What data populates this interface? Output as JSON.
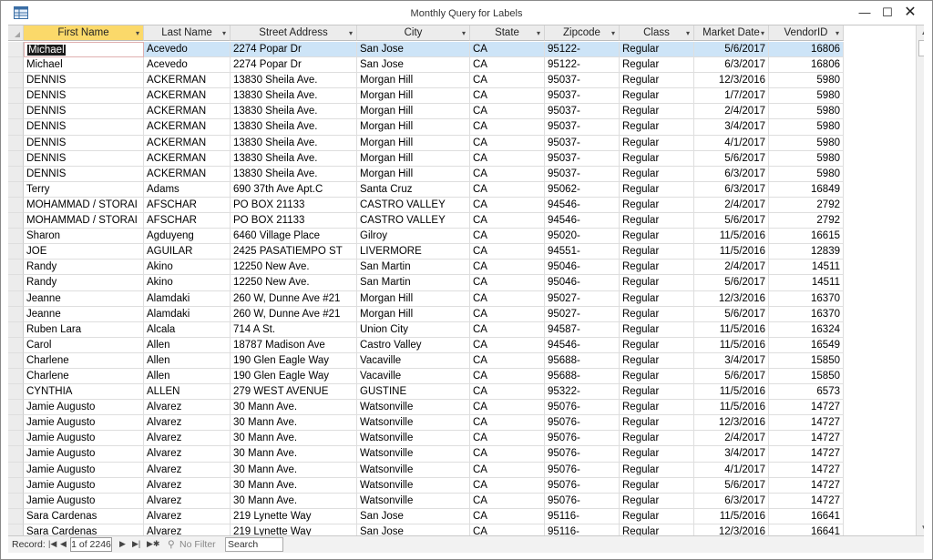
{
  "window": {
    "title": "Monthly Query for Labels",
    "minimize_glyph": "—",
    "maximize_glyph": "☐",
    "close_glyph": "✕"
  },
  "columns": [
    {
      "label": "First Name",
      "width": 132
    },
    {
      "label": "Last Name",
      "width": 95
    },
    {
      "label": "Street Address",
      "width": 139
    },
    {
      "label": "City",
      "width": 124
    },
    {
      "label": "State",
      "width": 82
    },
    {
      "label": "Zipcode",
      "width": 82
    },
    {
      "label": "Class",
      "width": 82
    },
    {
      "label": "Market Date",
      "width": 82
    },
    {
      "label": "VendorID",
      "width": 82
    }
  ],
  "rows": [
    [
      "Michael",
      "Acevedo",
      "2274 Popar Dr",
      "San Jose",
      "CA",
      "95122-",
      "Regular",
      "5/6/2017",
      "16806"
    ],
    [
      "Michael",
      "Acevedo",
      "2274 Popar Dr",
      "San Jose",
      "CA",
      "95122-",
      "Regular",
      "6/3/2017",
      "16806"
    ],
    [
      "DENNIS",
      "ACKERMAN",
      "13830 Sheila Ave.",
      "Morgan Hill",
      "CA",
      "95037-",
      "Regular",
      "12/3/2016",
      "5980"
    ],
    [
      "DENNIS",
      "ACKERMAN",
      "13830 Sheila Ave.",
      "Morgan Hill",
      "CA",
      "95037-",
      "Regular",
      "1/7/2017",
      "5980"
    ],
    [
      "DENNIS",
      "ACKERMAN",
      "13830 Sheila Ave.",
      "Morgan Hill",
      "CA",
      "95037-",
      "Regular",
      "2/4/2017",
      "5980"
    ],
    [
      "DENNIS",
      "ACKERMAN",
      "13830 Sheila Ave.",
      "Morgan Hill",
      "CA",
      "95037-",
      "Regular",
      "3/4/2017",
      "5980"
    ],
    [
      "DENNIS",
      "ACKERMAN",
      "13830 Sheila Ave.",
      "Morgan Hill",
      "CA",
      "95037-",
      "Regular",
      "4/1/2017",
      "5980"
    ],
    [
      "DENNIS",
      "ACKERMAN",
      "13830 Sheila Ave.",
      "Morgan Hill",
      "CA",
      "95037-",
      "Regular",
      "5/6/2017",
      "5980"
    ],
    [
      "DENNIS",
      "ACKERMAN",
      "13830 Sheila Ave.",
      "Morgan Hill",
      "CA",
      "95037-",
      "Regular",
      "6/3/2017",
      "5980"
    ],
    [
      "Terry",
      "Adams",
      "690 37th Ave Apt.C",
      "Santa Cruz",
      "CA",
      "95062-",
      "Regular",
      "6/3/2017",
      "16849"
    ],
    [
      "MOHAMMAD / STORAI",
      "AFSCHAR",
      "PO BOX 21133",
      "CASTRO VALLEY",
      "CA",
      "94546-",
      "Regular",
      "2/4/2017",
      "2792"
    ],
    [
      "MOHAMMAD / STORAI",
      "AFSCHAR",
      "PO BOX 21133",
      "CASTRO VALLEY",
      "CA",
      "94546-",
      "Regular",
      "5/6/2017",
      "2792"
    ],
    [
      "Sharon",
      "Agduyeng",
      "6460 Village Place",
      "Gilroy",
      "CA",
      "95020-",
      "Regular",
      "11/5/2016",
      "16615"
    ],
    [
      "JOE",
      "AGUILAR",
      "2425 PASATIEMPO ST",
      "LIVERMORE",
      "CA",
      "94551-",
      "Regular",
      "11/5/2016",
      "12839"
    ],
    [
      "Randy",
      "Akino",
      "12250 New Ave.",
      "San Martin",
      "CA",
      "95046-",
      "Regular",
      "2/4/2017",
      "14511"
    ],
    [
      "Randy",
      "Akino",
      "12250 New Ave.",
      "San Martin",
      "CA",
      "95046-",
      "Regular",
      "5/6/2017",
      "14511"
    ],
    [
      "Jeanne",
      "Alamdaki",
      "260 W, Dunne Ave #21",
      "Morgan Hill",
      "CA",
      "95027-",
      "Regular",
      "12/3/2016",
      "16370"
    ],
    [
      "Jeanne",
      "Alamdaki",
      "260 W, Dunne Ave #21",
      "Morgan Hill",
      "CA",
      "95027-",
      "Regular",
      "5/6/2017",
      "16370"
    ],
    [
      "Ruben Lara",
      "Alcala",
      "714 A St.",
      "Union City",
      "CA",
      "94587-",
      "Regular",
      "11/5/2016",
      "16324"
    ],
    [
      "Carol",
      "Allen",
      "18787 Madison Ave",
      "Castro Valley",
      "CA",
      "94546-",
      "Regular",
      "11/5/2016",
      "16549"
    ],
    [
      "Charlene",
      "Allen",
      "190 Glen Eagle Way",
      "Vacaville",
      "CA",
      "95688-",
      "Regular",
      "3/4/2017",
      "15850"
    ],
    [
      "Charlene",
      "Allen",
      "190 Glen Eagle Way",
      "Vacaville",
      "CA",
      "95688-",
      "Regular",
      "5/6/2017",
      "15850"
    ],
    [
      "CYNTHIA",
      "ALLEN",
      "279 WEST AVENUE",
      "GUSTINE",
      "CA",
      "95322-",
      "Regular",
      "11/5/2016",
      "6573"
    ],
    [
      "Jamie Augusto",
      "Alvarez",
      "30 Mann Ave.",
      "Watsonville",
      "CA",
      "95076-",
      "Regular",
      "11/5/2016",
      "14727"
    ],
    [
      "Jamie Augusto",
      "Alvarez",
      "30 Mann Ave.",
      "Watsonville",
      "CA",
      "95076-",
      "Regular",
      "12/3/2016",
      "14727"
    ],
    [
      "Jamie Augusto",
      "Alvarez",
      "30 Mann Ave.",
      "Watsonville",
      "CA",
      "95076-",
      "Regular",
      "2/4/2017",
      "14727"
    ],
    [
      "Jamie Augusto",
      "Alvarez",
      "30 Mann Ave.",
      "Watsonville",
      "CA",
      "95076-",
      "Regular",
      "3/4/2017",
      "14727"
    ],
    [
      "Jamie Augusto",
      "Alvarez",
      "30 Mann Ave.",
      "Watsonville",
      "CA",
      "95076-",
      "Regular",
      "4/1/2017",
      "14727"
    ],
    [
      "Jamie Augusto",
      "Alvarez",
      "30 Mann Ave.",
      "Watsonville",
      "CA",
      "95076-",
      "Regular",
      "5/6/2017",
      "14727"
    ],
    [
      "Jamie Augusto",
      "Alvarez",
      "30 Mann Ave.",
      "Watsonville",
      "CA",
      "95076-",
      "Regular",
      "6/3/2017",
      "14727"
    ],
    [
      "Sara Cardenas",
      "Alvarez",
      "219 Lynette Way",
      "San Jose",
      "CA",
      "95116-",
      "Regular",
      "11/5/2016",
      "16641"
    ],
    [
      "Sara Cardenas",
      "Alvarez",
      "219 Lynette Way",
      "San Jose",
      "CA",
      "95116-",
      "Regular",
      "12/3/2016",
      "16641"
    ]
  ],
  "navbar": {
    "record_label": "Record:",
    "first_glyph": "|◀",
    "prev_glyph": "◀",
    "position": "1 of 2246",
    "next_glyph": "▶",
    "last_glyph": "▶|",
    "new_glyph": "▶✱",
    "filter_label": "No Filter",
    "search_label": "Search"
  }
}
